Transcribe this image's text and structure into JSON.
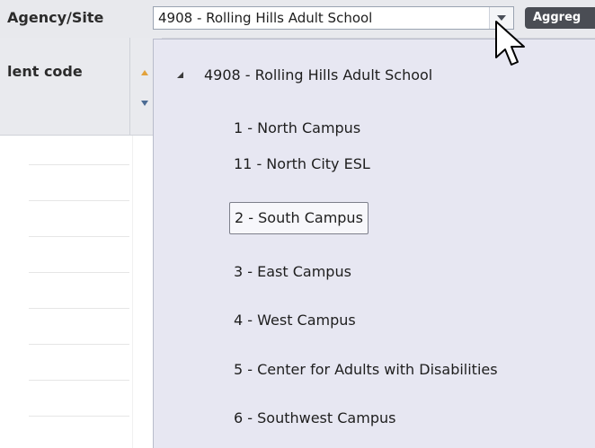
{
  "toolbar": {
    "agency_label": "Agency/Site",
    "site_value": "4908 - Rolling Hills Adult School",
    "aggregate_label": "Aggreg"
  },
  "grid": {
    "column_header": "lent code"
  },
  "dropdown": {
    "root": "4908 - Rolling Hills Adult School",
    "items": [
      {
        "label": "1 - North Campus",
        "selected": false
      },
      {
        "label": "11 - North City ESL",
        "selected": false
      },
      {
        "label": "2 - South Campus",
        "selected": true
      },
      {
        "label": "3 - East Campus",
        "selected": false
      },
      {
        "label": "4 - West Campus",
        "selected": false
      },
      {
        "label": "5 - Center for Adults with Disabilities",
        "selected": false
      },
      {
        "label": "6 - Southwest Campus",
        "selected": false
      }
    ]
  },
  "icons": {
    "dropdown_arrow": "chevron-down-icon",
    "expander": "tree-expanded-icon",
    "cursor": "mouse-pointer-icon",
    "sort": "sort-icon"
  },
  "colors": {
    "toolbar_bg": "#e8e9ed",
    "popup_bg": "#e7e7f2",
    "aggregate_bg": "#4a4d54",
    "sort_up": "#e2a23b",
    "sort_down": "#4b6b93"
  }
}
